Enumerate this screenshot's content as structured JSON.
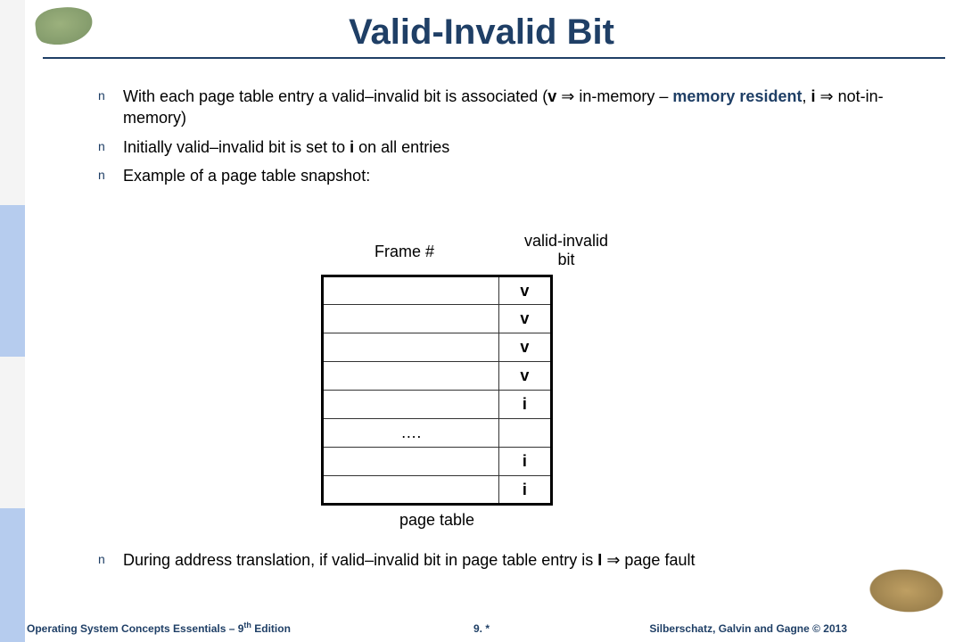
{
  "title": "Valid-Invalid Bit",
  "bullets": {
    "b1_pre": "With each page table entry a valid–invalid bit is associated (",
    "b1_v": "v",
    "b1_arrow1": " ⇒ in-memory – ",
    "b1_mr": "memory resident",
    "b1_comma": ", ",
    "b1_i": "i",
    "b1_arrow2": " ⇒ not-in-memory)",
    "b2_pre": "Initially valid–invalid bit is set to ",
    "b2_i": "i",
    "b2_post": " on all entries",
    "b3": "Example of a page table snapshot:",
    "b4_pre": "During address translation, if valid–invalid bit in page table entry is ",
    "b4_I": "I",
    "b4_post": " ⇒ page fault"
  },
  "figure": {
    "header_frame": "Frame #",
    "header_vbit_l1": "valid-invalid",
    "header_vbit_l2": "bit",
    "rows": [
      {
        "frame": "",
        "bit": "v"
      },
      {
        "frame": "",
        "bit": "v"
      },
      {
        "frame": "",
        "bit": "v"
      },
      {
        "frame": "",
        "bit": "v"
      },
      {
        "frame": "",
        "bit": "i"
      },
      {
        "frame": "….",
        "bit": ""
      },
      {
        "frame": "",
        "bit": "i"
      },
      {
        "frame": "",
        "bit": "i"
      }
    ],
    "caption": "page table"
  },
  "footer": {
    "left_pre": "Operating System Concepts Essentials – 9",
    "left_sup": "th",
    "left_post": " Edition",
    "mid": "9. *",
    "right": "Silberschatz, Galvin and Gagne © 2013"
  }
}
